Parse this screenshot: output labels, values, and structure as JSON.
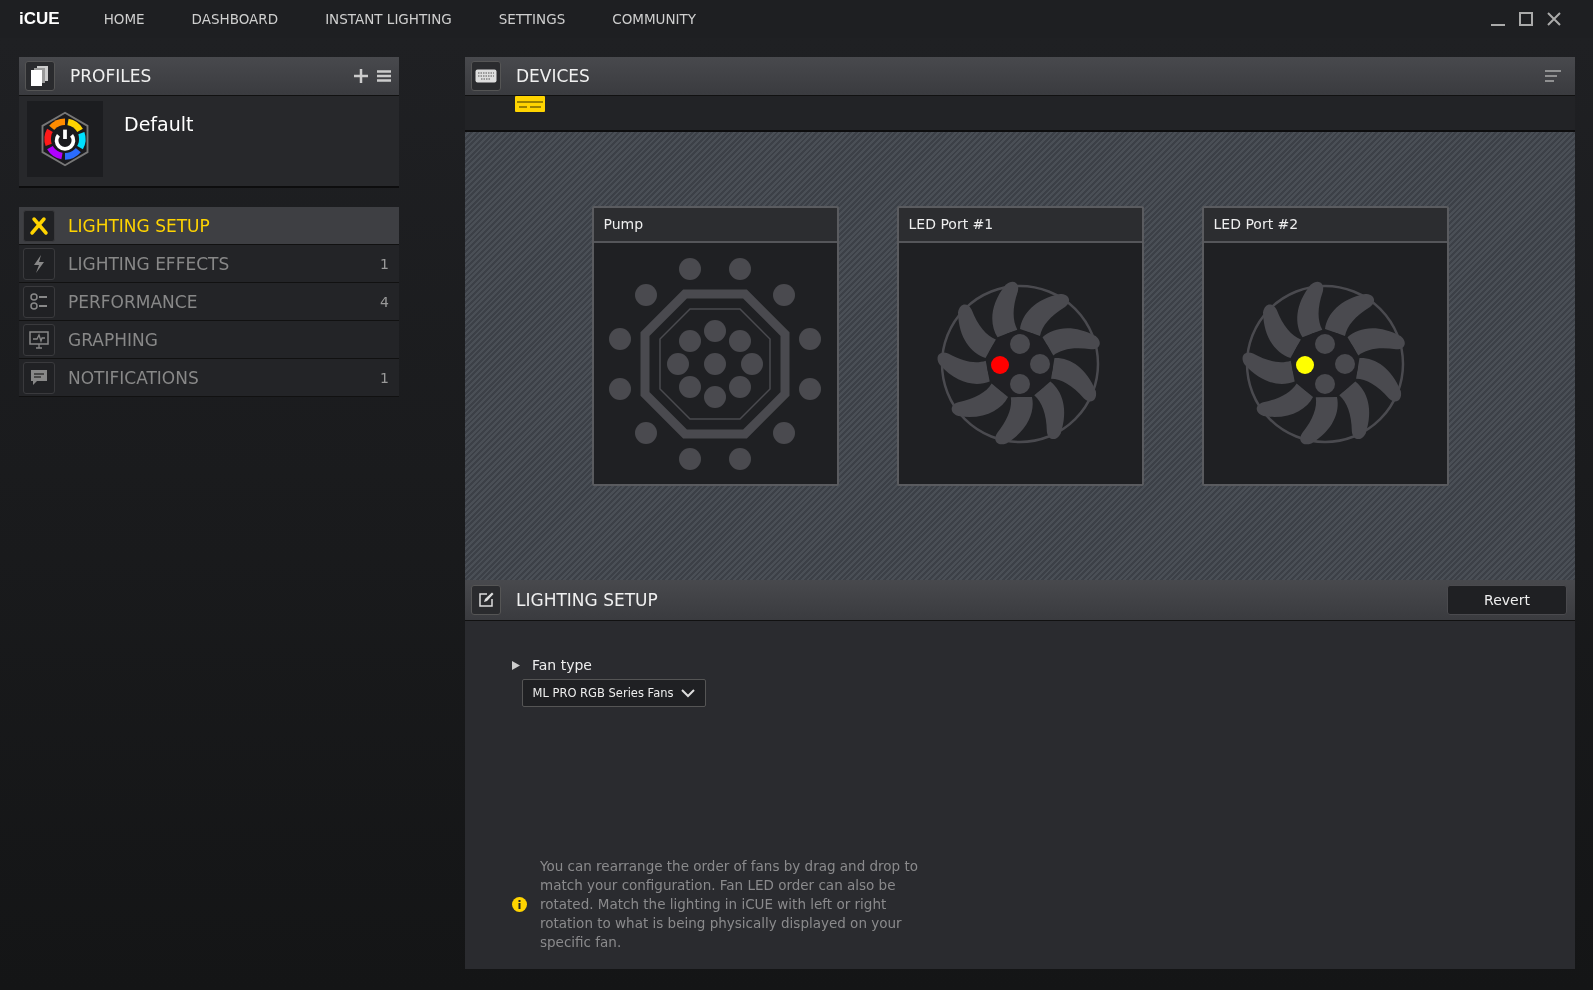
{
  "app": {
    "logo": "iCUE"
  },
  "nav": [
    {
      "label": "HOME"
    },
    {
      "label": "DASHBOARD"
    },
    {
      "label": "INSTANT LIGHTING"
    },
    {
      "label": "SETTINGS"
    },
    {
      "label": "COMMUNITY"
    }
  ],
  "profiles": {
    "title": "PROFILES",
    "items": [
      {
        "name": "Default"
      }
    ]
  },
  "sidebar": {
    "items": [
      {
        "label": "LIGHTING SETUP",
        "selected": true
      },
      {
        "label": "LIGHTING EFFECTS",
        "count": "1",
        "selected": false
      },
      {
        "label": "PERFORMANCE",
        "count": "4",
        "selected": false
      },
      {
        "label": "GRAPHING",
        "selected": false
      },
      {
        "label": "NOTIFICATIONS",
        "count": "1",
        "selected": false
      }
    ]
  },
  "devices": {
    "title": "DEVICES",
    "cards": [
      {
        "title": "Pump",
        "kind": "pump"
      },
      {
        "title": "LED Port #1",
        "kind": "fan",
        "color": "#ff0000"
      },
      {
        "title": "LED Port #2",
        "kind": "fan",
        "color": "#ffff00"
      }
    ]
  },
  "lighting_setup": {
    "title": "LIGHTING SETUP",
    "revert": "Revert",
    "fan_type": {
      "label": "Fan type",
      "expanded": false,
      "value": "ML PRO RGB Series Fans"
    },
    "info": "You can rearrange the order of fans by drag and drop to match your configuration. Fan LED order can also be rotated. Match the lighting in iCUE with left or right rotation to what is being physically displayed on your specific fan."
  }
}
